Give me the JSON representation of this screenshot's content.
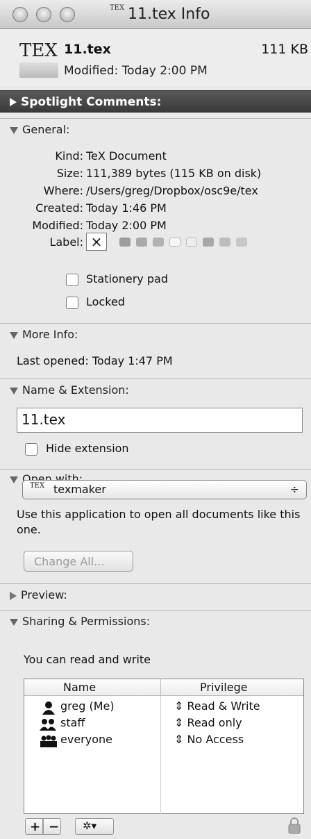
{
  "window": {
    "title": "11.tex Info",
    "title_icon_text": "TEX"
  },
  "header": {
    "logo_text": "TEX",
    "file_name": "11.tex",
    "file_size": "111 KB",
    "modified": "Modified: Today 2:00 PM"
  },
  "sections": {
    "spotlight": "Spotlight Comments:",
    "general": "General:",
    "more_info": "More Info:",
    "name_ext": "Name & Extension:",
    "open_with": "Open with:",
    "preview": "Preview:",
    "sharing": "Sharing & Permissions:"
  },
  "general": {
    "kind_key": "Kind:",
    "kind_val": "TeX Document",
    "size_key": "Size:",
    "size_val": "111,389 bytes (115 KB on disk)",
    "where_key": "Where:",
    "where_val": "/Users/greg/Dropbox/osc9e/tex",
    "created_key": "Created:",
    "created_val": "Today 1:46 PM",
    "modified_key": "Modified:",
    "modified_val": "Today 2:00 PM",
    "label_key": "Label:",
    "label_none": "×",
    "stationery": "Stationery pad",
    "locked": "Locked"
  },
  "more_info": {
    "last_opened": "Last opened: Today 1:47 PM"
  },
  "name_ext": {
    "field_value": "11.tex",
    "hide_extension": "Hide extension"
  },
  "open_with": {
    "app_icon_text": "TEX",
    "app": "texmaker",
    "popup_arrows": "÷",
    "description": "Use this application to open all documents like this one.",
    "change_all": "Change All..."
  },
  "sharing": {
    "summary": "You can read and write",
    "col_name": "Name",
    "col_privilege": "Privilege",
    "rows": [
      {
        "name": "greg (Me)",
        "privilege": "Read & Write"
      },
      {
        "name": "staff",
        "privilege": "Read only"
      },
      {
        "name": "everyone",
        "privilege": "No Access"
      }
    ],
    "add": "+",
    "remove": "−",
    "gear": "✲▾"
  }
}
